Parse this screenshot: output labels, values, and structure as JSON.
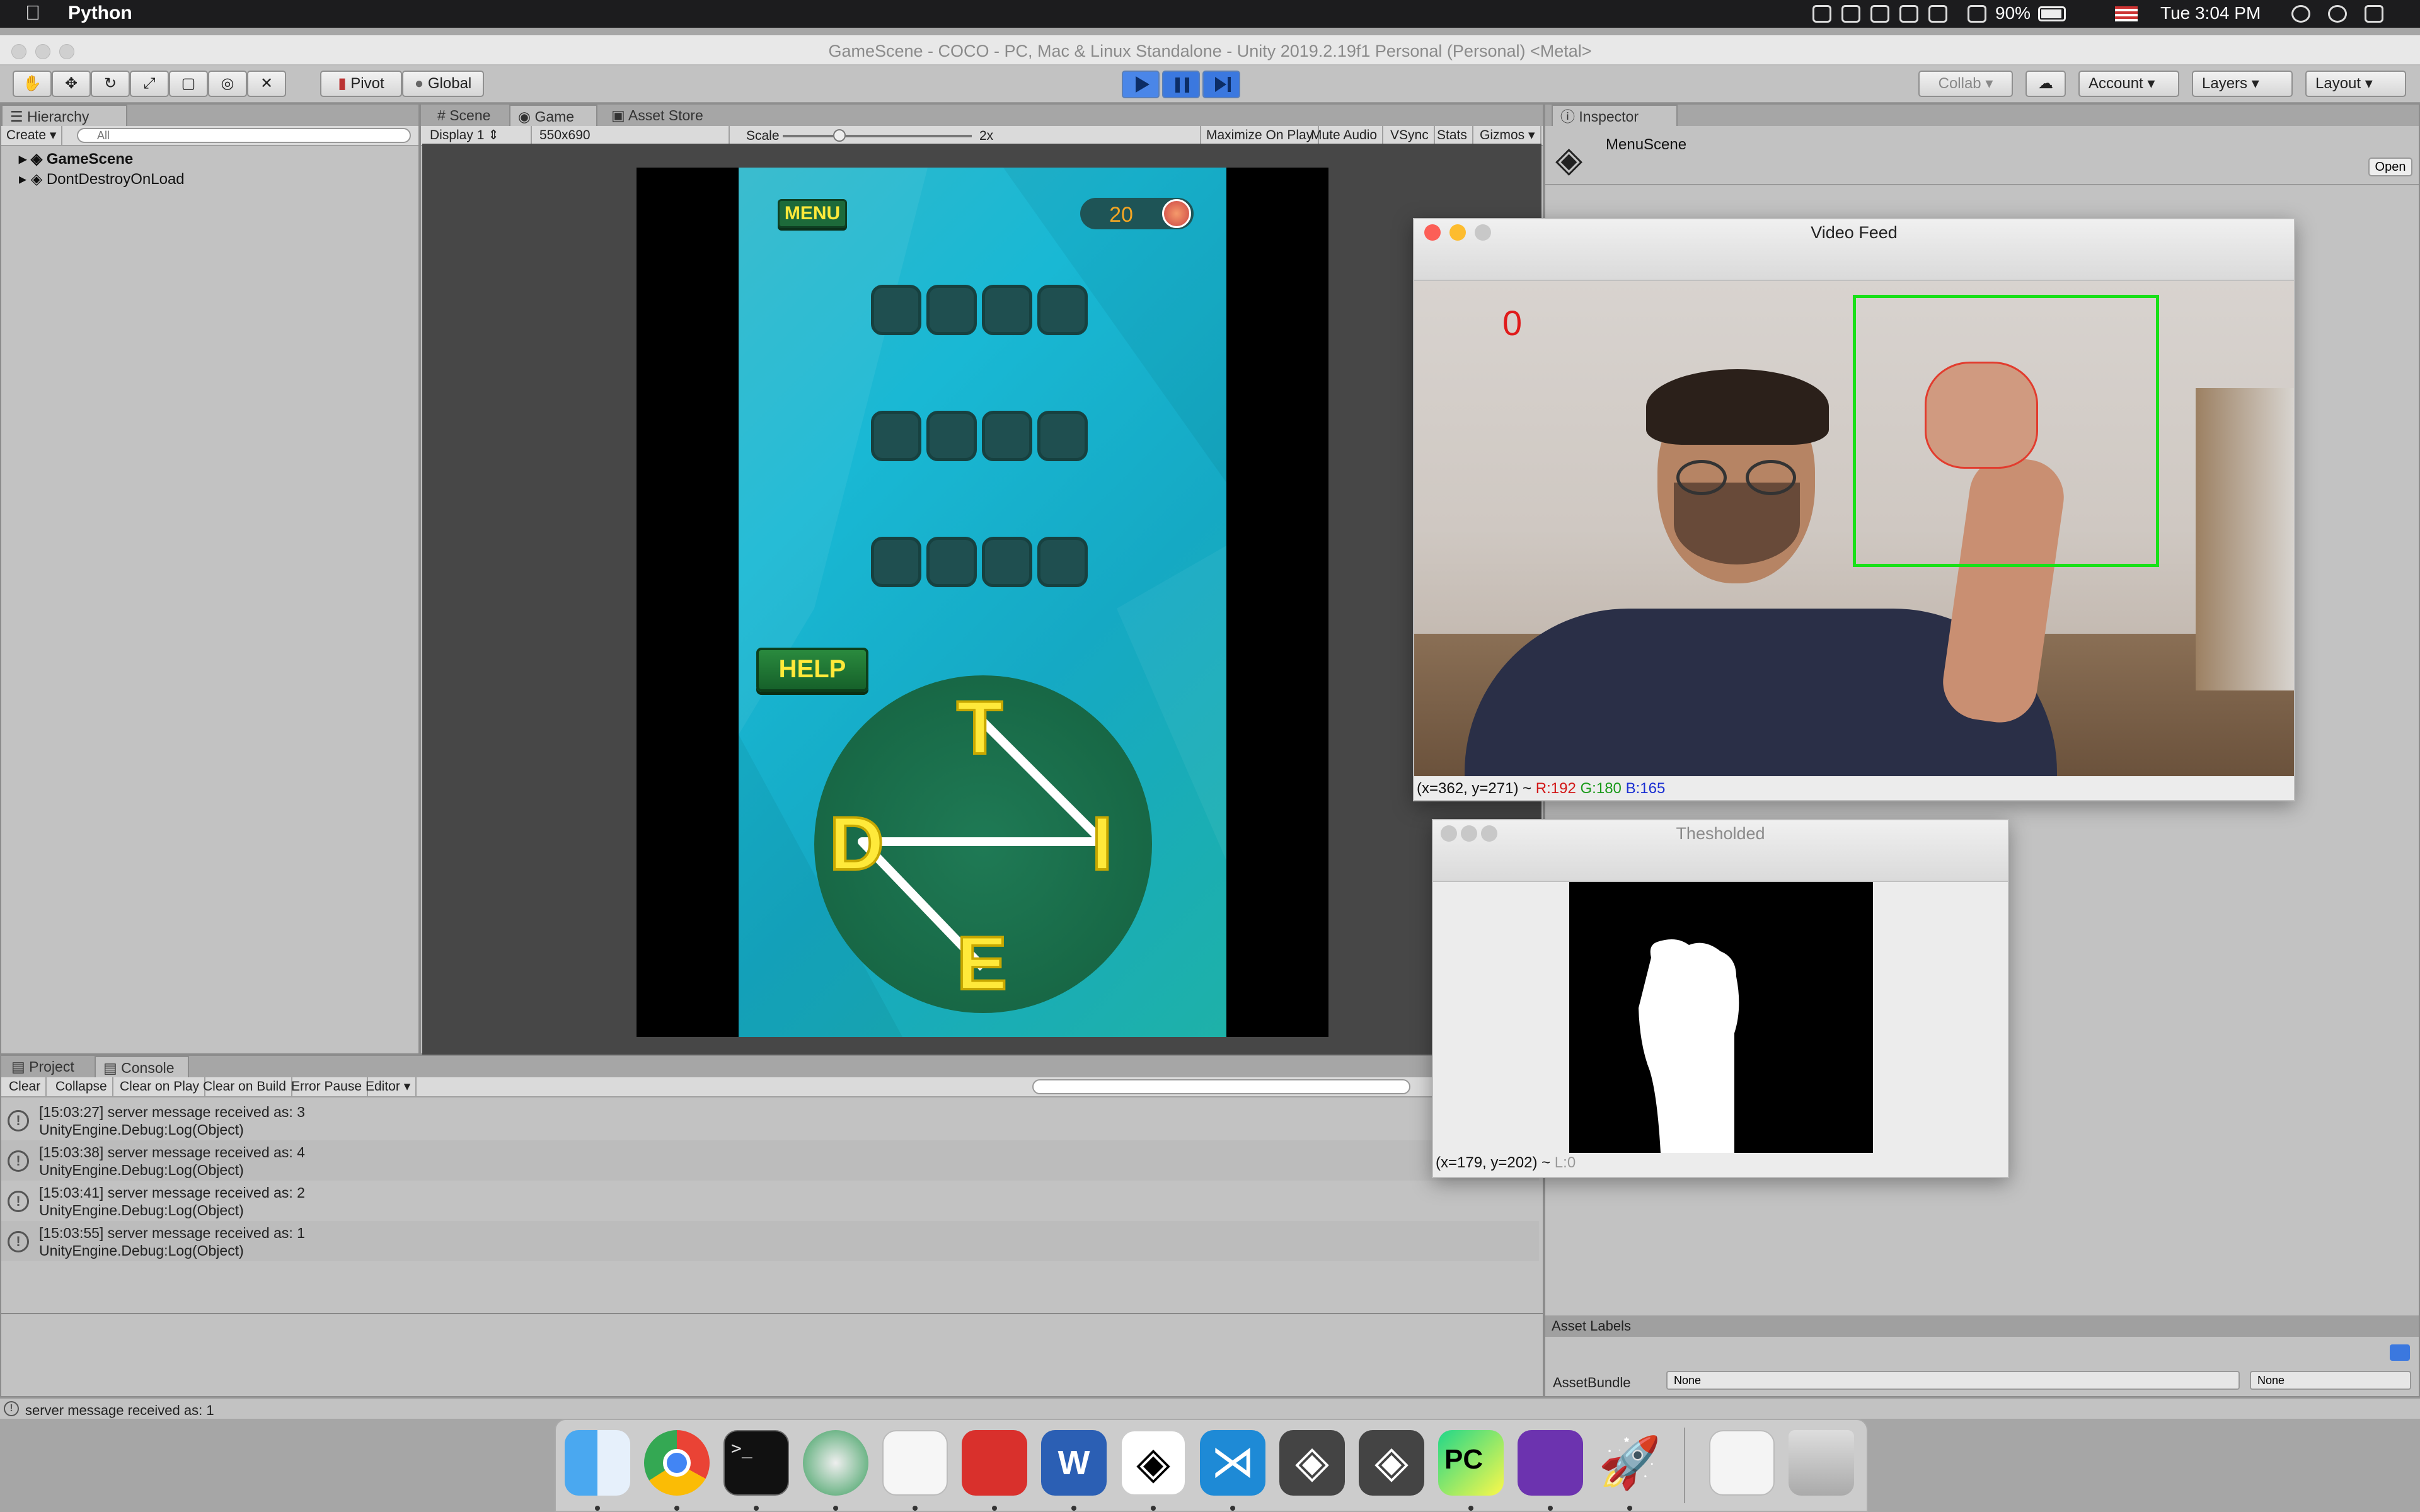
{
  "menubar": {
    "app_name": "Python",
    "battery": "90%",
    "clock": "Tue 3:04 PM"
  },
  "window": {
    "title": "GameScene - COCO - PC, Mac & Linux Standalone - Unity 2019.2.19f1 Personal (Personal) <Metal>"
  },
  "toolbar": {
    "pivot": "Pivot",
    "global": "Global",
    "collab": "Collab",
    "account": "Account",
    "layers": "Layers",
    "layout": "Layout"
  },
  "hierarchy": {
    "tab": "Hierarchy",
    "create": "Create",
    "search_placeholder": "All",
    "items": [
      {
        "label": "GameScene"
      },
      {
        "label": "DontDestroyOnLoad"
      }
    ]
  },
  "game_tabs": {
    "scene": "Scene",
    "game": "Game",
    "asset_store": "Asset Store"
  },
  "game_bar": {
    "display": "Display 1",
    "resolution": "550x690",
    "scale_label": "Scale",
    "scale_value": "2x",
    "maximize": "Maximize On Play",
    "mute": "Mute Audio",
    "vsync": "VSync",
    "stats": "Stats",
    "gizmos": "Gizmos"
  },
  "game": {
    "menu_label": "MENU",
    "score": "20",
    "help_label": "HELP",
    "wheel_letters": [
      "T",
      "I",
      "E",
      "D"
    ]
  },
  "inspector": {
    "tab": "Inspector",
    "object_name": "MenuScene",
    "open_label": "Open",
    "asset_labels": "Asset Labels",
    "asset_bundle": "AssetBundle",
    "bundle_value": "None",
    "variant_value": "None"
  },
  "video_feed": {
    "title": "Video Feed",
    "count": "0",
    "status_prefix": "(x=362, y=271) ~ ",
    "r": "R:192",
    "g": "G:180",
    "b": "B:165"
  },
  "thresholded": {
    "title": "Thesholded",
    "status_prefix": "(x=179, y=202) ~ ",
    "l": "L:0"
  },
  "console": {
    "project_tab": "Project",
    "console_tab": "Console",
    "buttons": [
      "Clear",
      "Collapse",
      "Clear on Play",
      "Clear on Build",
      "Error Pause",
      "Editor"
    ],
    "logs": [
      {
        "line1": "[15:03:27] server message received as: 3",
        "line2": "UnityEngine.Debug:Log(Object)"
      },
      {
        "line1": "[15:03:38] server message received as: 4",
        "line2": "UnityEngine.Debug:Log(Object)"
      },
      {
        "line1": "[15:03:41] server message received as: 2",
        "line2": "UnityEngine.Debug:Log(Object)"
      },
      {
        "line1": "[15:03:55] server message received as: 1",
        "line2": "UnityEngine.Debug:Log(Object)"
      }
    ],
    "status": "server message received as: 1"
  },
  "dock": {
    "apps": [
      "finder-icon",
      "chrome-icon",
      "terminal-icon",
      "network-icon",
      "textedit-icon",
      "pdf-icon",
      "word-icon",
      "unity-icon",
      "vscode-icon",
      "unity-icon",
      "unity-icon",
      "pycharm-icon",
      "visual-studio-icon",
      "rocket-icon",
      "document-icon",
      "trash-icon"
    ]
  }
}
